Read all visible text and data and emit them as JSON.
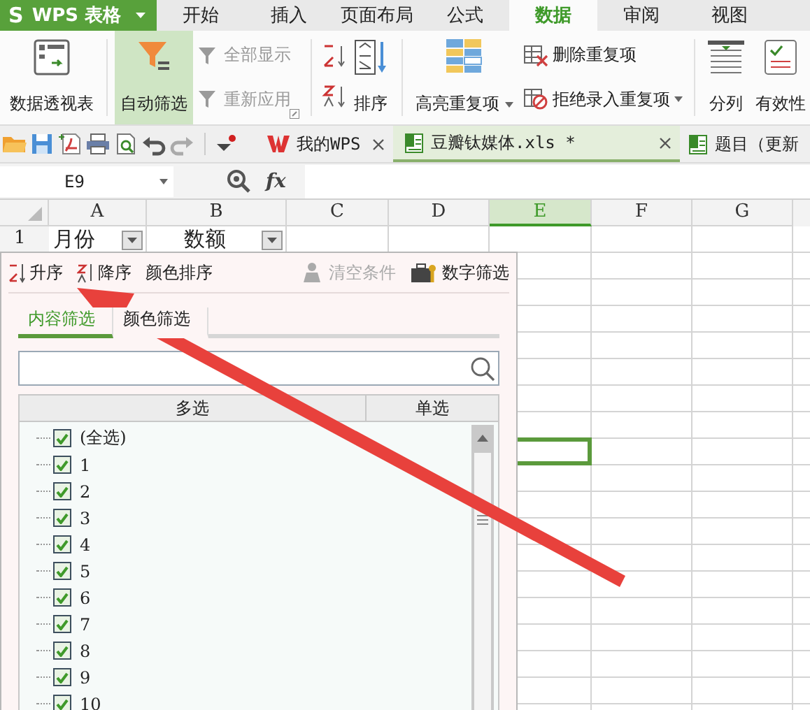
{
  "app_menu": {
    "logo": "S",
    "label": "WPS 表格"
  },
  "menu_tabs": [
    {
      "label": "开始",
      "selected": false
    },
    {
      "label": "插入",
      "selected": false
    },
    {
      "label": "页面布局",
      "selected": false
    },
    {
      "label": "公式",
      "selected": false
    },
    {
      "label": "数据",
      "selected": true
    },
    {
      "label": "审阅",
      "selected": false
    },
    {
      "label": "视图",
      "selected": false
    }
  ],
  "ribbon": {
    "pivot": {
      "label": "数据透视表"
    },
    "autofilter": {
      "label": "自动筛选",
      "selected": true
    },
    "filter_actions": [
      {
        "label": "全部显示",
        "disabled": true
      },
      {
        "label": "重新应用",
        "disabled": true
      }
    ],
    "sort": {
      "label": "排序"
    },
    "highlight_duplicates": {
      "label": "高亮重复项"
    },
    "duplicate_actions": [
      {
        "label": "删除重复项",
        "dropdown": false
      },
      {
        "label": "拒绝录入重复项",
        "dropdown": true
      }
    ],
    "split": {
      "label": "分列"
    },
    "validity": {
      "label": "有效性"
    }
  },
  "doc_tabs": [
    {
      "label": "我的WPS",
      "kind": "home",
      "selected": false,
      "closable": true
    },
    {
      "label": "豆瓣钛媒体.xls *",
      "kind": "sheet",
      "selected": true,
      "closable": true
    },
    {
      "label": "题目（更新",
      "kind": "sheet",
      "selected": false,
      "closable": false
    }
  ],
  "formula_bar": {
    "name_box": "E9",
    "fx": "fx"
  },
  "sheet": {
    "columns": [
      {
        "label": "A",
        "selected": false
      },
      {
        "label": "B",
        "selected": false
      },
      {
        "label": "C",
        "selected": false
      },
      {
        "label": "D",
        "selected": false
      },
      {
        "label": "E",
        "selected": true
      },
      {
        "label": "F",
        "selected": false
      },
      {
        "label": "G",
        "selected": false
      }
    ],
    "header_row": {
      "number": "1",
      "cells": [
        {
          "text": "月份",
          "filter": true
        },
        {
          "text": "数额",
          "filter": true
        }
      ]
    }
  },
  "filter_popup": {
    "sort_actions": [
      {
        "label": "升序",
        "kind": "asc"
      },
      {
        "label": "降序",
        "kind": "desc"
      },
      {
        "label": "颜色排序",
        "kind": "color"
      }
    ],
    "condition_actions": [
      {
        "label": "清空条件",
        "kind": "clear",
        "disabled": true
      },
      {
        "label": "数字筛选",
        "kind": "number",
        "disabled": false
      }
    ],
    "tabs": [
      {
        "label": "内容筛选",
        "selected": true
      },
      {
        "label": "颜色筛选",
        "selected": false
      }
    ],
    "list_header": [
      "多选",
      "单选"
    ],
    "items": [
      {
        "label": "(全选)",
        "checked": true
      },
      {
        "label": "1",
        "checked": true
      },
      {
        "label": "2",
        "checked": true
      },
      {
        "label": "3",
        "checked": true
      },
      {
        "label": "4",
        "checked": true
      },
      {
        "label": "5",
        "checked": true
      },
      {
        "label": "6",
        "checked": true
      },
      {
        "label": "7",
        "checked": true
      },
      {
        "label": "8",
        "checked": true
      },
      {
        "label": "9",
        "checked": true
      },
      {
        "label": "10",
        "checked": true
      }
    ]
  }
}
